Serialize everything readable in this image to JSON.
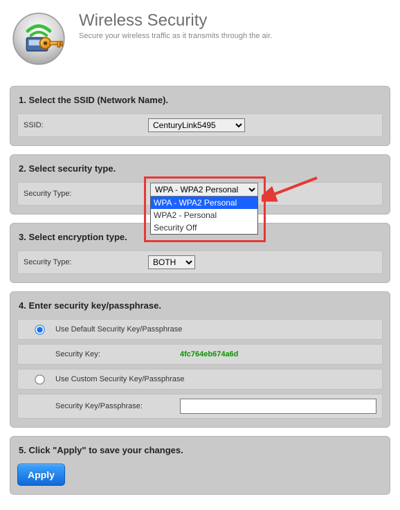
{
  "header": {
    "title": "Wireless Security",
    "subtitle": "Secure your wireless traffic as it transmits through the air."
  },
  "section1": {
    "title": "1. Select the SSID (Network Name).",
    "ssid_label": "SSID:",
    "ssid_value": "CenturyLink5495"
  },
  "section2": {
    "title": "2. Select security type.",
    "label": "Security Type:",
    "selected": "WPA - WPA2 Personal",
    "options": [
      "WPA - WPA2 Personal",
      "WPA2 - Personal",
      "Security Off"
    ]
  },
  "section3": {
    "title": "3. Select encryption type.",
    "label": "Security Type:",
    "value": "BOTH"
  },
  "section4": {
    "title": "4. Enter security key/passphrase.",
    "opt_default": "Use Default Security Key/Passphrase",
    "key_label": "Security Key:",
    "key_value": "4fc764eb674a6d",
    "opt_custom": "Use Custom Security Key/Passphrase",
    "custom_label": "Security Key/Passphrase:"
  },
  "section5": {
    "title": "5. Click \"Apply\" to save your changes.",
    "apply": "Apply"
  }
}
